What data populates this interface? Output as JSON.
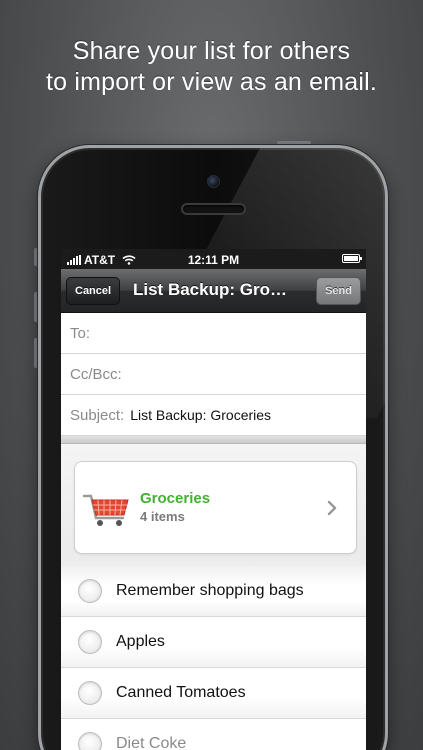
{
  "promo": {
    "line1": "Share your list for others",
    "line2": "to import or view as an email."
  },
  "statusbar": {
    "carrier": "AT&T",
    "time": "12:11 PM"
  },
  "navbar": {
    "cancel_label": "Cancel",
    "title": "List Backup: Gro…",
    "send_label": "Send"
  },
  "compose": {
    "to_label": "To:",
    "ccbcc_label": "Cc/Bcc:",
    "subject_label": "Subject:",
    "subject_value": "List Backup: Groceries"
  },
  "list_card": {
    "name": "Groceries",
    "count": "4 items",
    "accent": "#44b034",
    "icon": "shopping-cart-icon"
  },
  "items": [
    {
      "label": "Remember shopping bags"
    },
    {
      "label": "Apples"
    },
    {
      "label": "Canned Tomatoes"
    },
    {
      "label": "Diet Coke"
    }
  ]
}
